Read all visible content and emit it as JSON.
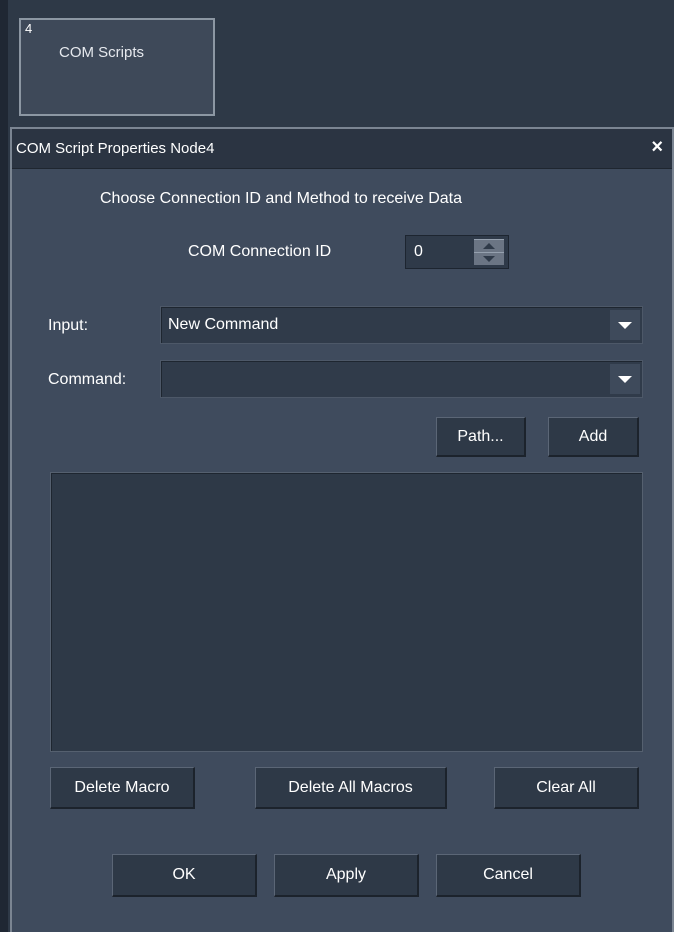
{
  "node": {
    "number": "4",
    "title": "COM Scripts"
  },
  "dialog": {
    "title": "COM Script Properties Node4",
    "close_symbol": "×",
    "instruction": "Choose Connection ID and Method to receive Data",
    "connection_label": "COM Connection ID",
    "connection_value": "0",
    "input_label": "Input:",
    "input_value": "New Command",
    "command_label": "Command:",
    "command_value": "",
    "buttons": {
      "path": "Path...",
      "add": "Add",
      "delete_macro": "Delete Macro",
      "delete_all_macros": "Delete All Macros",
      "clear_all": "Clear All",
      "ok": "OK",
      "apply": "Apply",
      "cancel": "Cancel"
    },
    "macro_list": []
  },
  "colors": {
    "background": "#2e3947",
    "dialog": "#3f4b5d",
    "title_bar": "#2b3442",
    "text": "#ffffff"
  }
}
